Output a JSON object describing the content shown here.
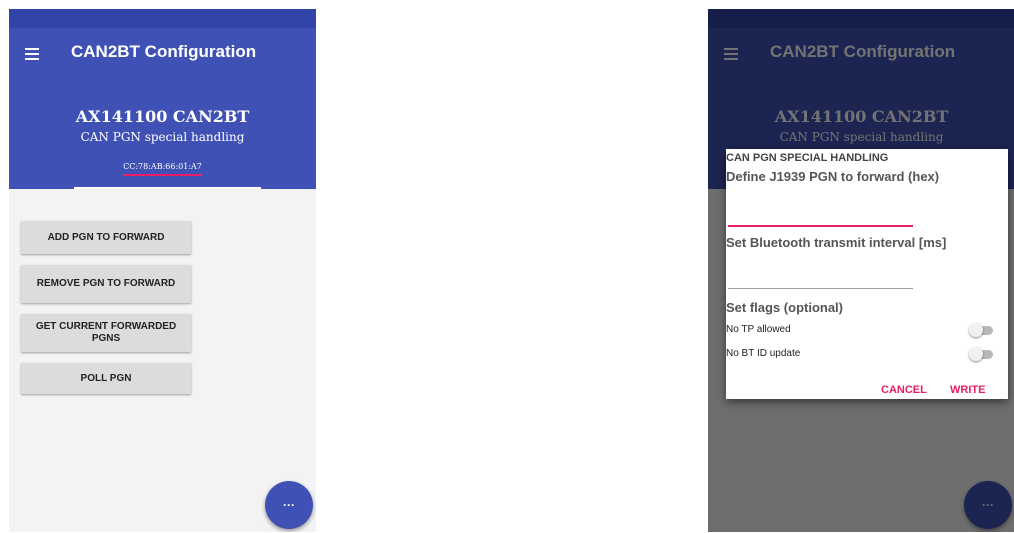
{
  "app": {
    "title": "CAN2BT Configuration",
    "device_name": "AX141100 CAN2BT",
    "device_subtitle": "CAN PGN special handling",
    "device_mac": "CC:78:AB:66:01:A7"
  },
  "buttons": {
    "add_pgn": "ADD PGN TO FORWARD",
    "remove_pgn": "REMOVE PGN TO FORWARD",
    "get_current": "GET CURRENT FORWARDED PGNS",
    "poll_pgn": "POLL PGN"
  },
  "fab": {
    "label": "···"
  },
  "dialog": {
    "title": "CAN PGN SPECIAL HANDLING",
    "pgn_label": "Define J1939 PGN to forward (hex)",
    "pgn_value": "",
    "interval_label": "Set Bluetooth transmit interval [ms]",
    "interval_value": "",
    "flags_label": "Set flags (optional)",
    "flag_no_tp": "No TP allowed",
    "flag_no_bt_id": "No BT ID update",
    "cancel": "CANCEL",
    "write": "WRITE"
  },
  "colors": {
    "primary": "#3f51b5",
    "primary_dark": "#3145a8",
    "accent": "#e91e63",
    "button_bg": "#dcdcdc"
  },
  "icons": {
    "menu": "menu-icon",
    "more": "more-icon"
  },
  "toggles": {
    "no_tp_allowed": false,
    "no_bt_id_update": false
  }
}
